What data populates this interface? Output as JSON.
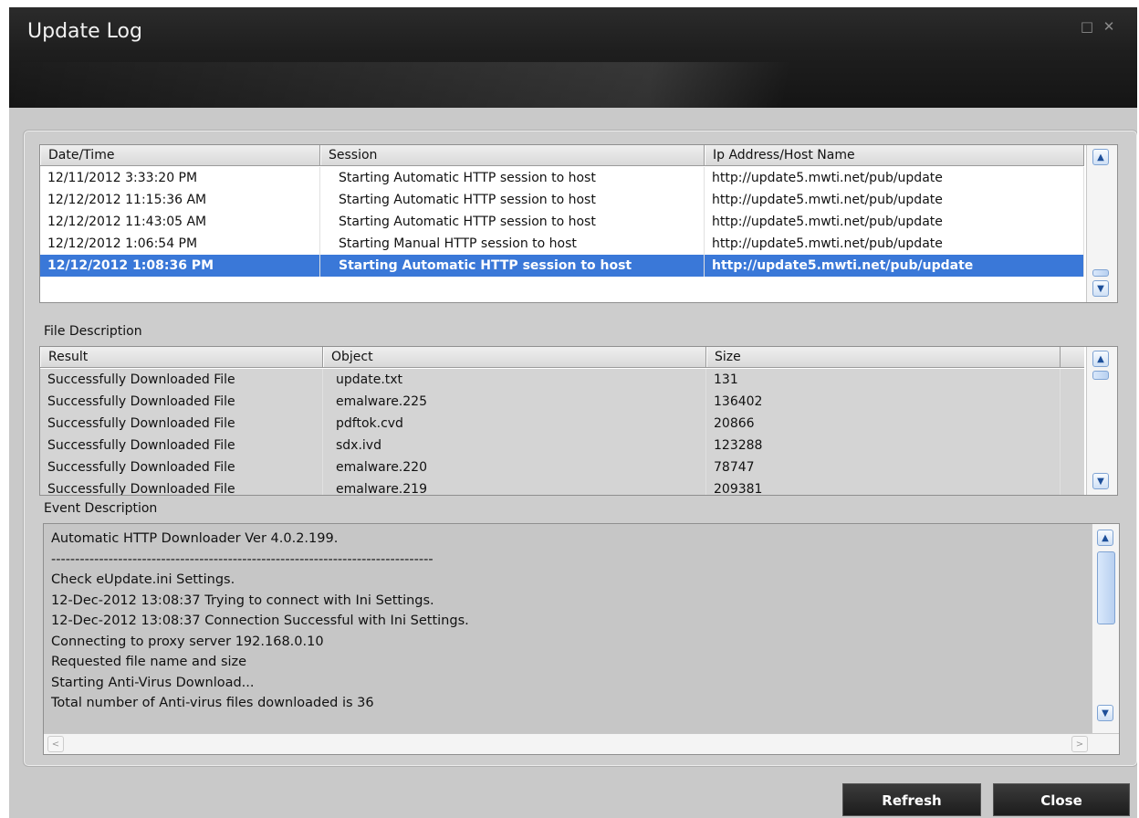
{
  "window": {
    "title": "Update Log",
    "maximize_glyph": "□",
    "close_glyph": "✕"
  },
  "session_table": {
    "columns": [
      "Date/Time",
      "Session",
      "Ip Address/Host Name"
    ],
    "rows": [
      [
        "12/11/2012 3:33:20 PM",
        "Starting Automatic HTTP session to host",
        "http://update5.mwti.net/pub/update"
      ],
      [
        "12/12/2012 11:15:36 AM",
        "Starting Automatic HTTP session to host",
        "http://update5.mwti.net/pub/update"
      ],
      [
        "12/12/2012 11:43:05 AM",
        "Starting Automatic HTTP session to host",
        "http://update5.mwti.net/pub/update"
      ],
      [
        "12/12/2012 1:06:54 PM",
        "Starting Manual HTTP session to host",
        "http://update5.mwti.net/pub/update"
      ],
      [
        "12/12/2012 1:08:36 PM",
        "Starting Automatic HTTP session to host",
        "http://update5.mwti.net/pub/update"
      ]
    ],
    "selected_row": 4
  },
  "file_description": {
    "label": "File Description",
    "columns": [
      "Result",
      "Object",
      "Size"
    ],
    "rows": [
      [
        "Successfully Downloaded File",
        "update.txt",
        "131"
      ],
      [
        "Successfully Downloaded File",
        "emalware.225",
        "136402"
      ],
      [
        "Successfully Downloaded File",
        "pdftok.cvd",
        "20866"
      ],
      [
        "Successfully Downloaded File",
        "sdx.ivd",
        "123288"
      ],
      [
        "Successfully Downloaded File",
        "emalware.220",
        "78747"
      ],
      [
        "Successfully Downloaded File",
        "emalware.219",
        "209381"
      ]
    ]
  },
  "event_description": {
    "label": "Event Description",
    "lines": [
      "Automatic HTTP Downloader Ver 4.0.2.199.",
      "--------------------------------------------------------------------------------",
      "Check eUpdate.ini Settings.",
      "12-Dec-2012 13:08:37 Trying to connect with Ini Settings.",
      "12-Dec-2012 13:08:37 Connection Successful with Ini Settings.",
      "Connecting to proxy server 192.168.0.10",
      "Requested file name and size",
      "Starting Anti-Virus Download...",
      "Total number of Anti-virus files downloaded is 36"
    ]
  },
  "buttons": {
    "refresh": "Refresh",
    "close": "Close"
  },
  "scroll_glyphs": {
    "up": "▲",
    "down": "▼",
    "left": "<",
    "right": ">"
  }
}
